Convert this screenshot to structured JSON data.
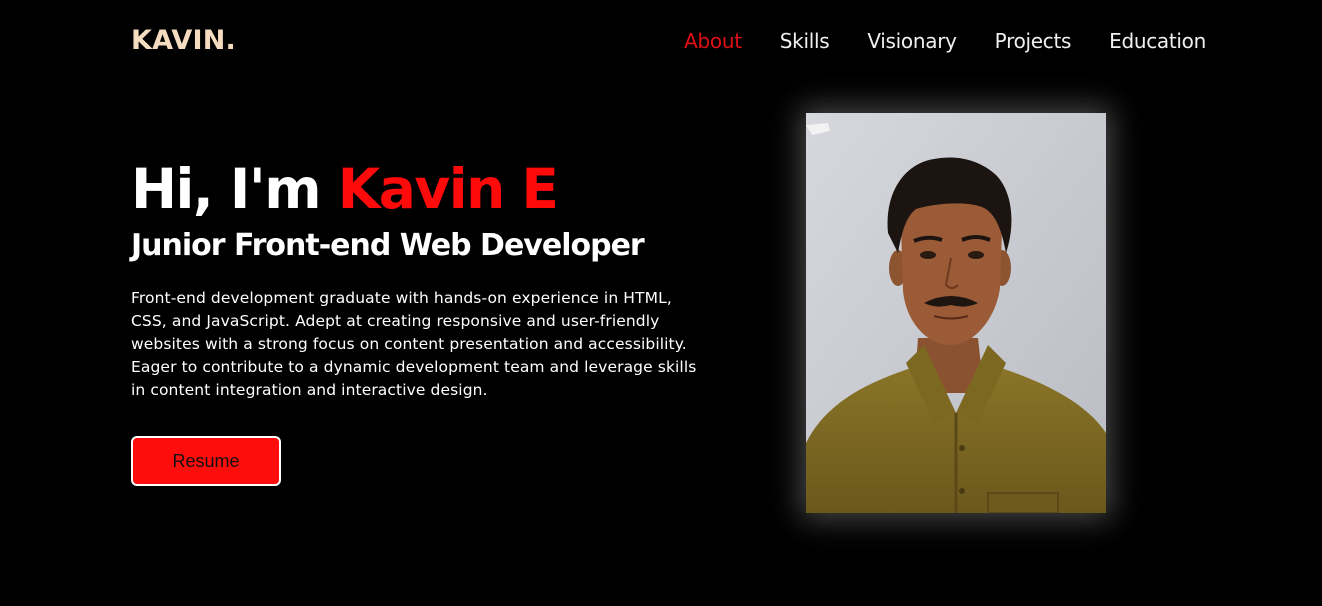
{
  "header": {
    "logo": "KAVIN.",
    "nav": [
      {
        "label": "About",
        "active": true
      },
      {
        "label": "Skills",
        "active": false
      },
      {
        "label": "Visionary",
        "active": false
      },
      {
        "label": "Projects",
        "active": false
      },
      {
        "label": "Education",
        "active": false
      }
    ]
  },
  "hero": {
    "greeting": "Hi, I'm ",
    "name": "Kavin E",
    "subtitle": "Junior Front-end Web Developer",
    "description": "Front-end development graduate with hands-on experience in HTML, CSS, and JavaScript. Adept at creating responsive and user-friendly websites with a strong focus on content presentation and accessibility. Eager to contribute to a dynamic development team and leverage skills in content integration and interactive design.",
    "resume_label": "Resume"
  },
  "colors": {
    "accent": "#ff0a0a",
    "logo": "#f5dcc0",
    "background": "#000000"
  }
}
